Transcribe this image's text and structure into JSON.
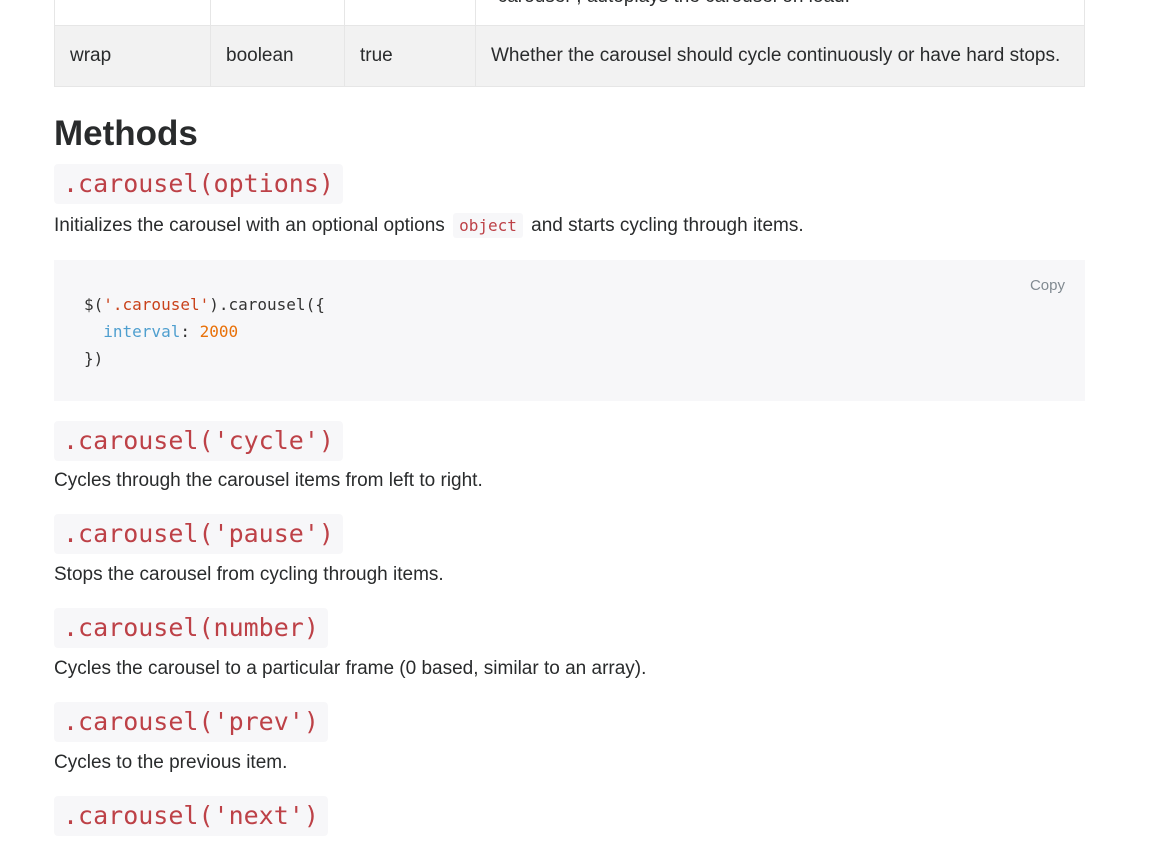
{
  "options_table": {
    "prev_row_description": "\"carousel\", autoplays the carousel on load.",
    "wrap_row": {
      "name": "wrap",
      "type": "boolean",
      "default": "true",
      "description": "Whether the carousel should cycle continuously or have hard stops."
    }
  },
  "methods": {
    "heading": "Methods",
    "items": [
      {
        "signature": ".carousel(options)",
        "description_before": "Initializes the carousel with an optional options",
        "description_code": "object",
        "description_after": "and starts cycling through items."
      },
      {
        "signature": ".carousel('cycle')",
        "description": "Cycles through the carousel items from left to right."
      },
      {
        "signature": ".carousel('pause')",
        "description": "Stops the carousel from cycling through items."
      },
      {
        "signature": ".carousel(number)",
        "description": "Cycles the carousel to a particular frame (0 based, similar to an array)."
      },
      {
        "signature": ".carousel('prev')",
        "description": "Cycles to the previous item."
      },
      {
        "signature": ".carousel('next')"
      }
    ]
  },
  "code_example": {
    "copy_label": "Copy",
    "line1_prefix": "$(",
    "line1_selector": "'.carousel'",
    "line1_suffix": ").carousel({",
    "line2_key": "interval",
    "line2_colon": ": ",
    "line2_value": "2000",
    "line3": "})"
  },
  "colors": {
    "code_text": "#bd4147",
    "code_background": "#f7f7f9",
    "table_row_highlight": "#f2f2f2"
  }
}
